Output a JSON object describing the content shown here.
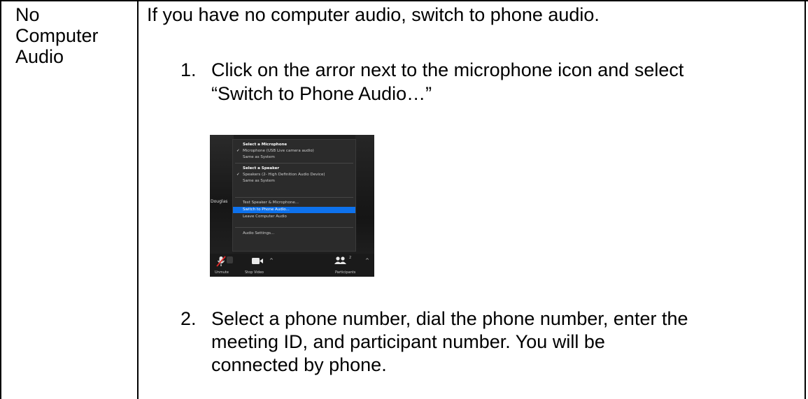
{
  "table": {
    "topic_lines": [
      "No",
      "Computer",
      "Audio"
    ],
    "intro": "If you have no computer audio, switch to phone audio.",
    "step1": {
      "number": "1.",
      "lines": [
        "Click on the arror next to the microphone icon and select",
        "“Switch to Phone Audio…”"
      ]
    },
    "step2": {
      "number": "2.",
      "lines": [
        "Select a phone number, dial the phone number, enter the",
        "meeting ID, and participant number.  You will be",
        "connected by phone."
      ]
    }
  },
  "screenshot": {
    "person_name": "Douglas",
    "menu": {
      "mic_header": "Select a Microphone",
      "mic_selected": "Microphone (USB Live camera audio)",
      "mic_same": "Same as System",
      "spk_header": "Select a Speaker",
      "spk_selected": "Speakers (2- High Definition Audio Device)",
      "spk_same": "Same as System",
      "test": "Test Speaker & Microphone...",
      "switch_phone": "Switch to Phone Audio...",
      "leave": "Leave Computer Audio",
      "settings": "Audio Settings...",
      "check_glyph": "✓"
    },
    "toolbar": {
      "unmute": "Unmute",
      "stop_video": "Stop Video",
      "participants": "Participants",
      "participants_count": "2",
      "caret": "^"
    },
    "colors": {
      "highlight": "#0e72ed",
      "menu_bg": "#2b2b2b",
      "mic_muted": "#e02828"
    }
  }
}
